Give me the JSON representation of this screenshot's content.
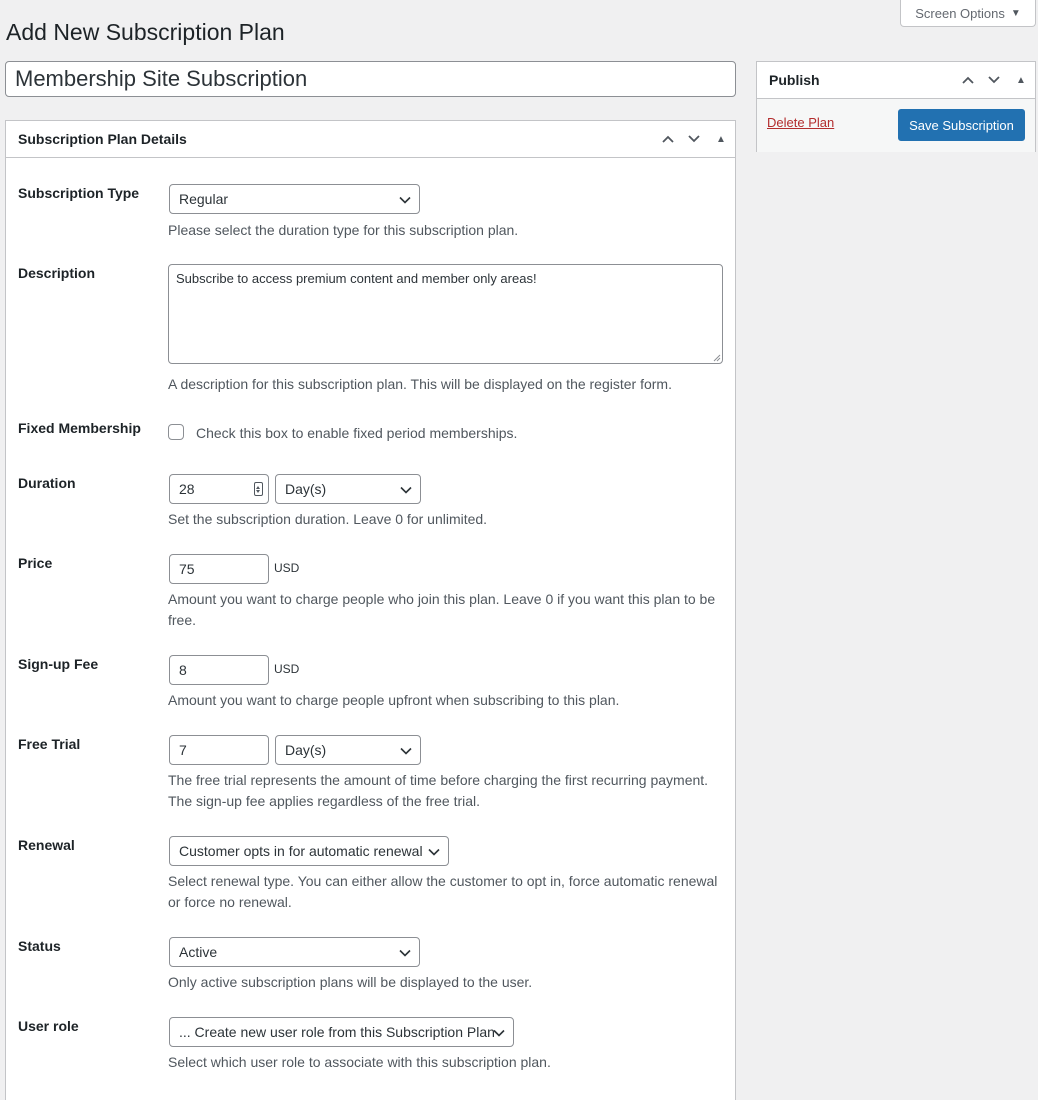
{
  "header": {
    "screen_options_label": "Screen Options",
    "page_title": "Add New Subscription Plan",
    "plan_title_value": "Membership Site Subscription"
  },
  "publish": {
    "title": "Publish",
    "delete_label": "Delete Plan",
    "save_label": "Save Subscription"
  },
  "details": {
    "title": "Subscription Plan Details",
    "subscription_type": {
      "label": "Subscription Type",
      "value": "Regular",
      "help": "Please select the duration type for this subscription plan."
    },
    "description": {
      "label": "Description",
      "value": "Subscribe to access premium content and member only areas!",
      "help": "A description for this subscription plan. This will be displayed on the register form."
    },
    "fixed_membership": {
      "label": "Fixed Membership",
      "checkbox_text": "Check this box to enable fixed period memberships.",
      "checked": false
    },
    "duration": {
      "label": "Duration",
      "value": "28",
      "unit": "Day(s)",
      "help": "Set the subscription duration. Leave 0 for unlimited."
    },
    "price": {
      "label": "Price",
      "value": "75",
      "currency": "USD",
      "help": "Amount you want to charge people who join this plan. Leave 0 if you want this plan to be free."
    },
    "signup_fee": {
      "label": "Sign-up Fee",
      "value": "8",
      "currency": "USD",
      "help": "Amount you want to charge people upfront when subscribing to this plan."
    },
    "free_trial": {
      "label": "Free Trial",
      "value": "7",
      "unit": "Day(s)",
      "help": "The free trial represents the amount of time before charging the first recurring payment. The sign-up fee applies regardless of the free trial."
    },
    "renewal": {
      "label": "Renewal",
      "value": "Customer opts in for automatic renewal",
      "help": "Select renewal type. You can either allow the customer to opt in, force automatic renewal or force no renewal."
    },
    "status": {
      "label": "Status",
      "value": "Active",
      "help": "Only active subscription plans will be displayed to the user."
    },
    "user_role": {
      "label": "User role",
      "value": "... Create new user role from this Subscription Plan",
      "help": "Select which user role to associate with this subscription plan."
    }
  },
  "colors": {
    "primary_button": "#2271b1",
    "delete_link": "#b32d2e",
    "background": "#f0f0f1"
  }
}
